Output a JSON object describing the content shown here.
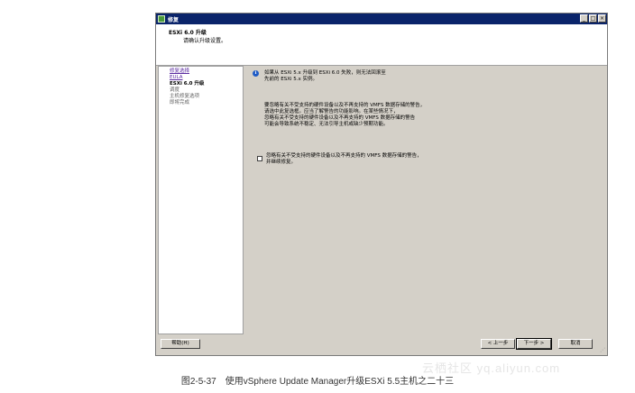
{
  "window": {
    "title": "修复"
  },
  "header": {
    "title": "ESXi 6.0 升级",
    "subtitle": "请确认升级设置。"
  },
  "nav": [
    {
      "label": "修复选择",
      "state": "link"
    },
    {
      "label": "EULA",
      "state": "link"
    },
    {
      "label": "ESXi 6.0 升级",
      "state": "current"
    },
    {
      "label": "调度",
      "state": "pending"
    },
    {
      "label": "主机修复选项",
      "state": "pending"
    },
    {
      "label": "即将完成",
      "state": "pending"
    }
  ],
  "main": {
    "info_line1": "如果从 ESXi 5.x 升级到 ESXi 6.0 失败，则无法回滚至",
    "info_line2": "先前的 ESXi 5.x 实例。",
    "warn_line1": "要忽略有关不受支持的硬件设备以及不再支持的 VMFS 数据存储的警告，",
    "warn_line2": "请选中此复选框。应当了解警告的功能影响。在某些情况下，",
    "warn_line3": "忽略有关不受支持的硬件设备以及不再支持的 VMFS 数据存储的警告",
    "warn_line4": "可能会导致系统不稳定、无法引导主机或缺少预期功能。",
    "checkbox_line1": "忽略有关不受支持的硬件设备以及不再支持的 VMFS 数据存储的警告，",
    "checkbox_line2": "并继续修复。",
    "checkbox_checked": false
  },
  "footer": {
    "help": "帮助(H)",
    "back": "< 上一步",
    "next": "下一步 >",
    "cancel": "取消"
  },
  "caption": "图2-5-37　使用vSphere Update Manager升级ESXi 5.5主机之二十三",
  "watermark": "云栖社区 yq.aliyun.com"
}
